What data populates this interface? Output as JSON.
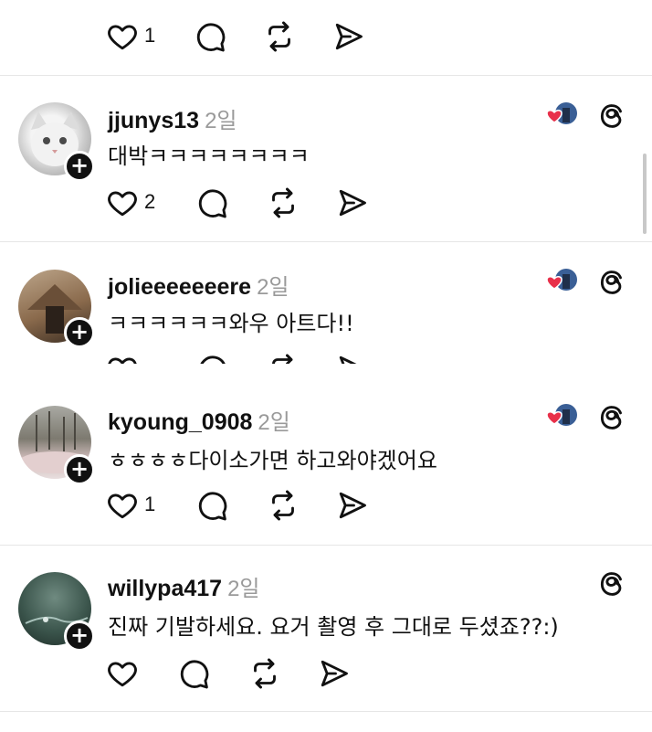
{
  "top_actions": {
    "like_count": "1"
  },
  "comments": [
    {
      "username": "jjunys13",
      "age": "2일",
      "text": "대박ㅋㅋㅋㅋㅋㅋㅋㅋ",
      "like_count": "2",
      "liked_by_author": true
    },
    {
      "username": "jolieeeeeeere",
      "age": "2일",
      "text": "ㅋㅋㅋㅋㅋㅋ와우 아트다!!",
      "like_count": "",
      "liked_by_author": true
    },
    {
      "username": "kyoung_0908",
      "age": "2일",
      "text": "ㅎㅎㅎㅎ다이소가면  하고와야겠어요",
      "like_count": "1",
      "liked_by_author": true
    },
    {
      "username": "willypa417",
      "age": "2일",
      "text": "진짜 기발하세요. 요거 촬영 후 그대로 두셨죠??:)",
      "like_count": "",
      "liked_by_author": false
    }
  ],
  "icons": {
    "like": "heart-icon",
    "reply": "comment-bubble-icon",
    "repost": "repost-icon",
    "share": "send-icon",
    "app": "threads-logo-icon",
    "follow": "plus-icon"
  },
  "colors": {
    "heart": "#e8304a",
    "divider": "#e6e6e6",
    "meta": "#9a9a9a"
  }
}
